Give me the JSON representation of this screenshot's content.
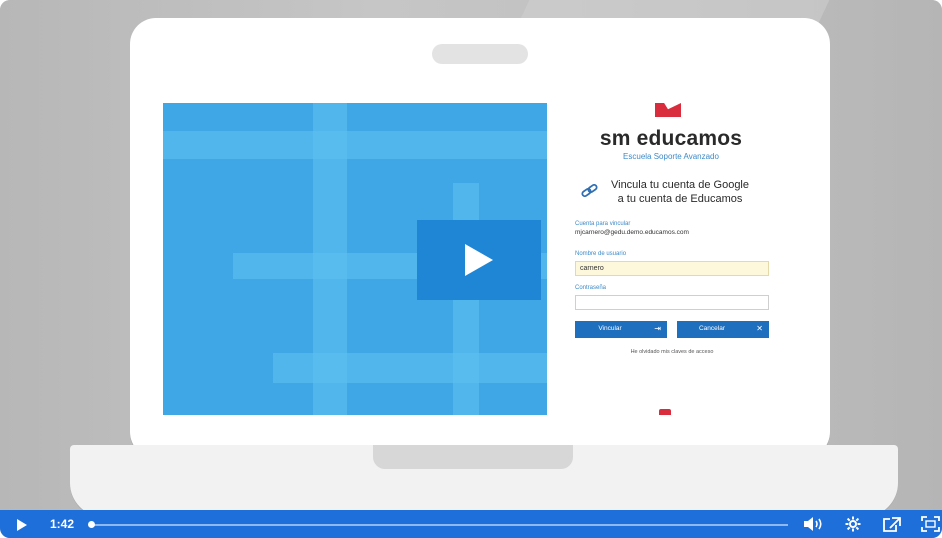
{
  "brand": {
    "name": "sm educamos",
    "subtitle": "Escuela Soporte Avanzado"
  },
  "login": {
    "heading_line1": "Vincula tu cuenta de Google",
    "heading_line2": "a tu cuenta de Educamos",
    "account_label": "Cuenta para vincular",
    "account_value": "mjcarnero@gedu.demo.educamos.com",
    "username_label": "Nombre de usuario",
    "username_value": "carnero",
    "password_label": "Contraseña",
    "password_value": "",
    "link_button": "Vincular",
    "cancel_button": "Cancelar",
    "forgot_link": "He olvidado mis claves de acceso"
  },
  "player": {
    "time": "1:42",
    "progress": 0.0
  },
  "colors": {
    "accent": "#1e6fd9",
    "video_bg": "#3fa7e6",
    "brand_red": "#d92d3e"
  },
  "icons": {
    "play": "play-icon",
    "volume": "volume-icon",
    "settings": "gear-icon",
    "share": "share-icon",
    "fullscreen": "fullscreen-icon",
    "link": "link-icon"
  }
}
